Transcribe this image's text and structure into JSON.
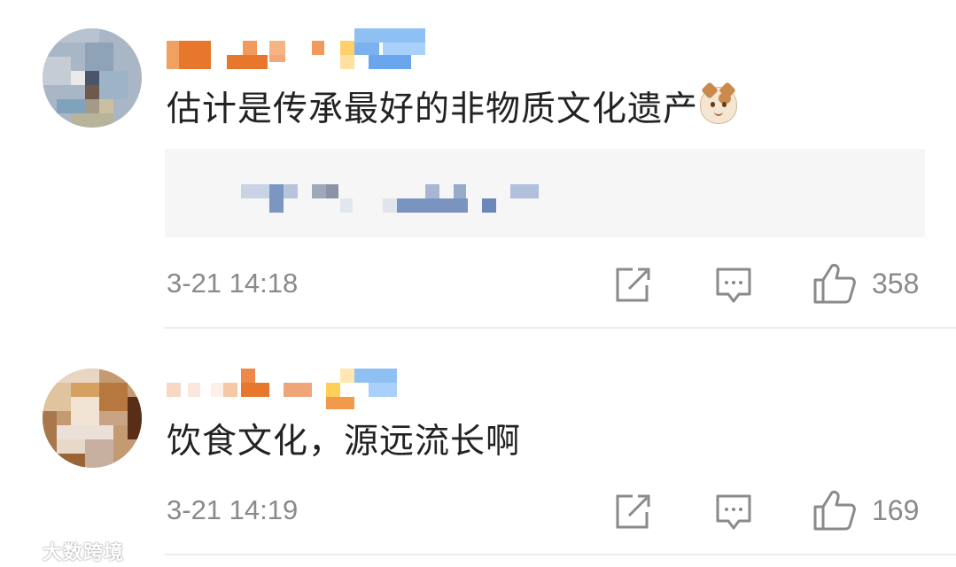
{
  "comments": [
    {
      "text": "估计是传承最好的非物质文化遗产",
      "emoji": "cat-face-emoji",
      "time": "3-21 14:18",
      "likes": "358"
    },
    {
      "text": "饮食文化，源远流长啊",
      "time": "3-21 14:19",
      "likes": "169"
    }
  ],
  "watermark": "大数跨境",
  "colors": {
    "text": "#222222",
    "meta": "#8a8a8a",
    "quote_bg": "#f6f6f6"
  }
}
